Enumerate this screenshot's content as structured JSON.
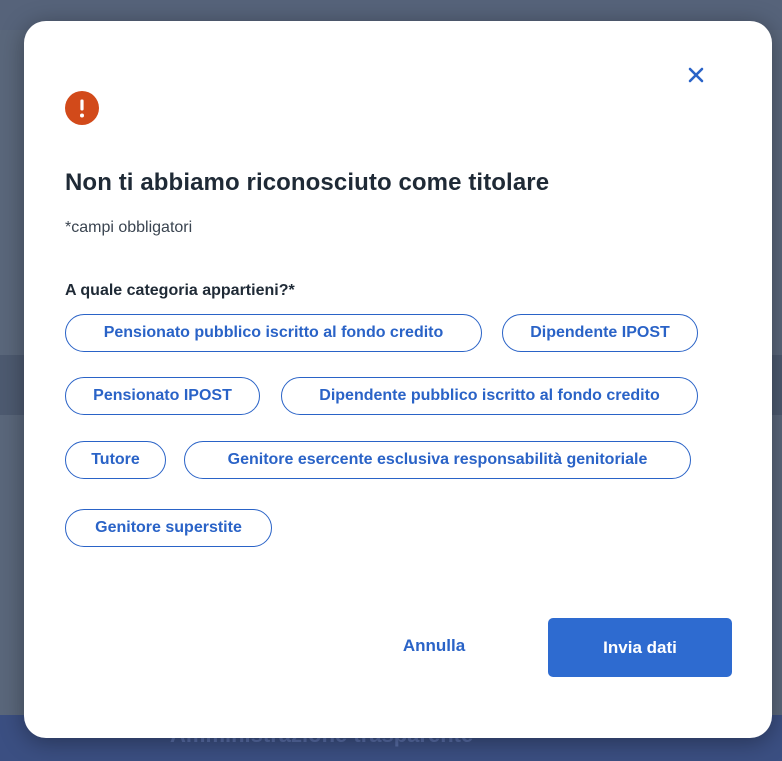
{
  "background": {
    "partial_text": "Amministrazione trasparente"
  },
  "modal": {
    "close_icon": "close-icon",
    "alert_icon": "exclamation-circle-icon",
    "alert_symbol": "!",
    "title": "Non ti abbiamo riconosciuto come titolare",
    "required_note": "*campi obbligatori",
    "question": "A quale categoria appartieni?*",
    "categories": [
      "Pensionato pubblico iscritto al fondo credito",
      "Dipendente IPOST",
      "Pensionato IPOST",
      "Dipendente pubblico iscritto al fondo credito",
      "Tutore",
      "Genitore esercente esclusiva responsabilità genitoriale",
      "Genitore superstite"
    ],
    "cancel_label": "Annulla",
    "submit_label": "Invia dati"
  },
  "colors": {
    "primary": "#2e6bd0",
    "alert": "#d24a1a",
    "title": "#1f2a36"
  }
}
